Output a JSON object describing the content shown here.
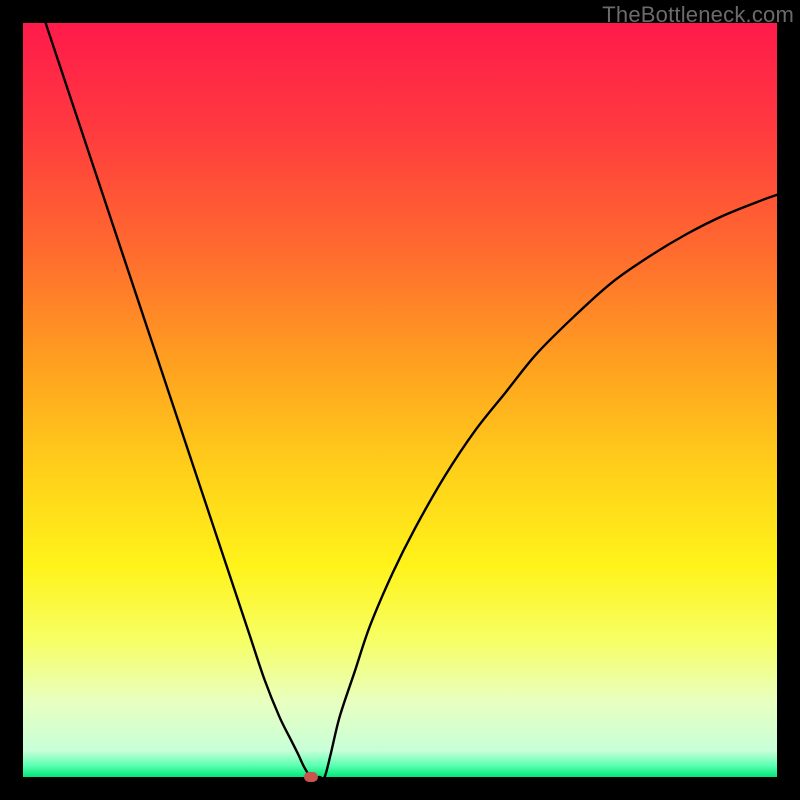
{
  "watermark": "TheBottleneck.com",
  "chart_data": {
    "type": "line",
    "title": "",
    "xlabel": "",
    "ylabel": "",
    "xlim": [
      0,
      100
    ],
    "ylim": [
      0,
      100
    ],
    "gradient_stops": [
      {
        "offset": 0.0,
        "color": "#ff1a4b"
      },
      {
        "offset": 0.14,
        "color": "#ff3a3f"
      },
      {
        "offset": 0.3,
        "color": "#ff6a2f"
      },
      {
        "offset": 0.46,
        "color": "#ffa31f"
      },
      {
        "offset": 0.6,
        "color": "#ffd21a"
      },
      {
        "offset": 0.72,
        "color": "#fff31a"
      },
      {
        "offset": 0.82,
        "color": "#f6ff66"
      },
      {
        "offset": 0.9,
        "color": "#e8ffc0"
      },
      {
        "offset": 0.965,
        "color": "#c8ffd8"
      },
      {
        "offset": 0.985,
        "color": "#5affb0"
      },
      {
        "offset": 1.0,
        "color": "#00e67a"
      }
    ],
    "series": [
      {
        "name": "bottleneck-curve",
        "x": [
          3,
          6,
          9,
          12,
          15,
          18,
          21,
          24,
          27,
          30,
          32,
          34,
          35.5,
          36.5,
          37.3,
          38.2,
          39.3,
          40,
          40.8,
          42,
          44,
          46,
          49,
          52,
          56,
          60,
          64,
          68,
          73,
          78,
          83,
          88,
          93,
          98,
          100
        ],
        "y": [
          100,
          91,
          82,
          73,
          64,
          55,
          46,
          37,
          28,
          19,
          13,
          8,
          5,
          3,
          1.3,
          0.0,
          0.0,
          0.0,
          3,
          8,
          14,
          20,
          27,
          33,
          40,
          46,
          51,
          56,
          61,
          65.5,
          69,
          72,
          74.5,
          76.5,
          77.2
        ]
      }
    ],
    "marker": {
      "x": 38.2,
      "y": 0.0,
      "color": "#c7544d"
    }
  }
}
